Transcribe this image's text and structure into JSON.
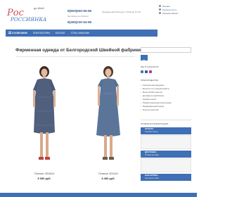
{
  "header": {
    "logo_small": "до 60ой",
    "logo_brand": "РОССИЯНКА",
    "phone_1": "8(800)600-55-85",
    "phone_1_note": "бесплатно по России",
    "phone_2": "8(495)230-54-85",
    "work_time": "Понедельник-Пятница с 10:00 до 17:00",
    "city": "Москва",
    "cart": "Корзина пуста",
    "cabinet": "Личный кабинет"
  },
  "nav": {
    "items": [
      "О КОМПАНИИ",
      "ПОКУПАТЕЛЯМ",
      "КАТАЛОГ",
      "ОТЗЫ ЗАКАЗЧИК"
    ]
  },
  "page": {
    "title": "Фирменная одежда от Белгородской Швейной фабрики"
  },
  "products": [
    {
      "name": "Платье 201524",
      "price": "3 300 руб."
    },
    {
      "name": "Платье 101110",
      "price": "3 400 руб."
    }
  ],
  "sidebar": {
    "search_placeholder": "",
    "social_heading": "МЫ В СОЦСЕТЯХ",
    "benefits_heading": "ПРЕИМУЩЕСТВА",
    "benefits": [
      "Оригинальная продукция",
      "Более 10 лет успешной работы",
      "Более 20 000 клиентов",
      "Доставка по всей России",
      "Удобная оплата",
      "Профессиональная консультация",
      "Индивидуальный подход",
      "Контроль качества"
    ],
    "info_heading": "ПОЛЕЗНАЯ ИНФОРМАЦИЯ",
    "info_buttons": [
      {
        "title": "ОПЛАТА",
        "desc": "Способы оплаты"
      },
      {
        "title": "ДОСТАВКА",
        "desc": "Условия доставки"
      },
      {
        "title": "КАК КУПИТЬ",
        "desc": "Как сделать заказ"
      }
    ]
  },
  "colors": {
    "accent": "#3f6fb4",
    "logo_red": "#d44b5c"
  }
}
